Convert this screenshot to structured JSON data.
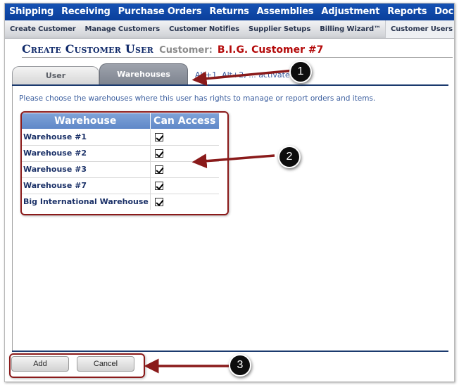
{
  "top_nav": [
    "Shipping",
    "Receiving",
    "Purchase Orders",
    "Returns",
    "Assemblies",
    "Adjustment",
    "Reports",
    "Doc"
  ],
  "sub_nav": {
    "items": [
      "Create Customer",
      "Manage Customers",
      "Customer Notifies",
      "Supplier Setups",
      "Billing Wizard™",
      "Customer Users"
    ],
    "active": "Customer Users"
  },
  "page": {
    "title": "Create Customer User",
    "customer_label": "Customer:",
    "customer_name": "B.I.G. Customer #7"
  },
  "tabs": {
    "items": [
      {
        "label": "User",
        "active": false
      },
      {
        "label": "Warehouses",
        "active": true
      }
    ],
    "hint": "Alt+1, Alt+2, ... activate tab"
  },
  "instructions": "Please choose the warehouses where this user has rights to manage or report orders and items.",
  "warehouse_table": {
    "headers": [
      "Warehouse",
      "Can Access"
    ],
    "rows": [
      {
        "name": "Warehouse #1",
        "can_access": true
      },
      {
        "name": "Warehouse #2",
        "can_access": true
      },
      {
        "name": "Warehouse #3",
        "can_access": true
      },
      {
        "name": "Warehouse #7",
        "can_access": true
      },
      {
        "name": "Big International Warehouse",
        "can_access": true
      }
    ]
  },
  "buttons": {
    "add": "Add",
    "cancel": "Cancel"
  },
  "annotations": {
    "badges": [
      "1",
      "2",
      "3"
    ],
    "color": "#8a1a1a"
  }
}
